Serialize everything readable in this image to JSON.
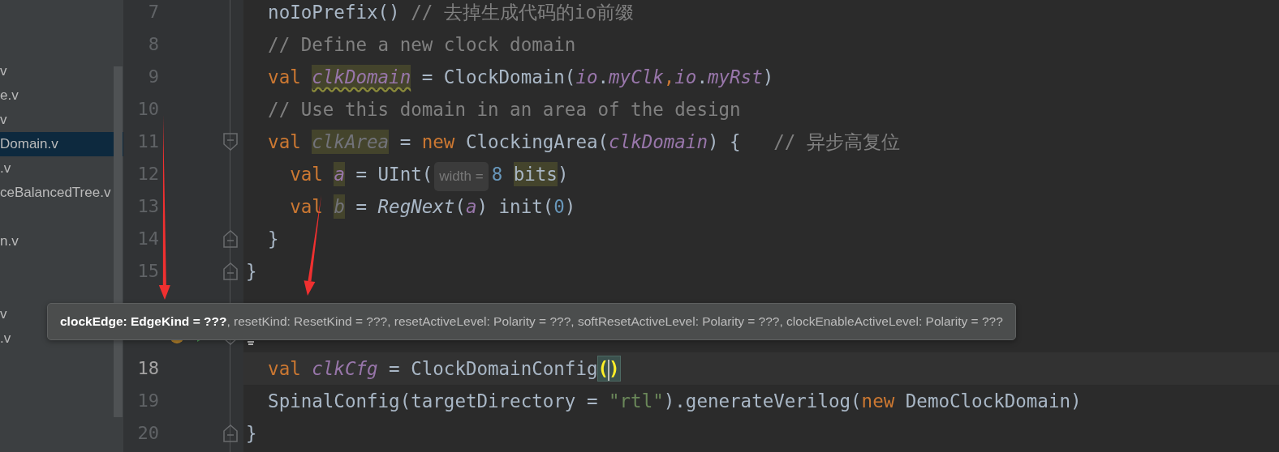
{
  "sidebar": {
    "items": [
      {
        "selected": false
      },
      {
        "selected": false
      },
      {
        "selected": false
      },
      {
        "label": "v",
        "selected": false
      },
      {
        "label": "e.v",
        "selected": false
      },
      {
        "label": "v",
        "selected": false
      },
      {
        "label": "Domain.v",
        "selected": true
      },
      {
        "label": ".v",
        "selected": false
      },
      {
        "label": "ceBalancedTree.v",
        "selected": false
      },
      {
        "selected": false
      },
      {
        "label": "n.v",
        "selected": false
      },
      {
        "selected": false
      },
      {
        "selected": false
      },
      {
        "label": "v",
        "selected": false
      },
      {
        "label": ".v",
        "selected": false
      }
    ]
  },
  "editor": {
    "lines": [
      {
        "number": "7",
        "current": false,
        "fold_start": false,
        "fold_end": false,
        "tokens": [
          {
            "text": "  noIoPrefix() ",
            "kind": "plain"
          },
          {
            "text": "// 去掉生成代码的io前缀",
            "kind": "comment"
          }
        ]
      },
      {
        "number": "8",
        "current": false,
        "fold_start": false,
        "fold_end": false,
        "tokens": [
          {
            "text": "  // Define a new clock domain",
            "kind": "comment"
          }
        ]
      },
      {
        "number": "9",
        "current": false,
        "fold_start": false,
        "fold_end": false,
        "tokens": [
          {
            "text": "  val ",
            "kind": "keyword"
          },
          {
            "text": "clkDomain",
            "kind": "field-warn"
          },
          {
            "text": " = ClockDomain(",
            "kind": "plain"
          },
          {
            "text": "io",
            "kind": "field"
          },
          {
            "text": ".",
            "kind": "plain"
          },
          {
            "text": "myClk",
            "kind": "field"
          },
          {
            "text": ",",
            "kind": "keyword"
          },
          {
            "text": "io",
            "kind": "field"
          },
          {
            "text": ".",
            "kind": "plain"
          },
          {
            "text": "myRst",
            "kind": "field"
          },
          {
            "text": ")",
            "kind": "plain"
          }
        ]
      },
      {
        "number": "10",
        "current": false,
        "fold_start": false,
        "fold_end": false,
        "tokens": [
          {
            "text": "  // Use this domain in an area of the design",
            "kind": "comment"
          }
        ]
      },
      {
        "number": "11",
        "current": false,
        "fold_start": true,
        "fold_end": false,
        "tokens": [
          {
            "text": "  val ",
            "kind": "keyword"
          },
          {
            "text": "clkArea",
            "kind": "unused"
          },
          {
            "text": " = ",
            "kind": "plain"
          },
          {
            "text": "new",
            "kind": "keyword"
          },
          {
            "text": " ClockingArea(",
            "kind": "plain"
          },
          {
            "text": "clkDomain",
            "kind": "field"
          },
          {
            "text": ") {   ",
            "kind": "plain"
          },
          {
            "text": "// 异步高复位",
            "kind": "comment"
          }
        ]
      },
      {
        "number": "12",
        "current": false,
        "fold_start": false,
        "fold_end": false,
        "tokens": [
          {
            "text": "    val ",
            "kind": "keyword"
          },
          {
            "text": "a",
            "kind": "field-mark"
          },
          {
            "text": " = UInt(",
            "kind": "plain"
          },
          {
            "text": "width =",
            "kind": "hint"
          },
          {
            "text": "8 ",
            "kind": "number"
          },
          {
            "text": "bits",
            "kind": "plain-mark"
          },
          {
            "text": ")",
            "kind": "plain"
          }
        ]
      },
      {
        "number": "13",
        "current": false,
        "fold_start": false,
        "fold_end": false,
        "tokens": [
          {
            "text": "    val ",
            "kind": "keyword"
          },
          {
            "text": "b",
            "kind": "unused"
          },
          {
            "text": " = ",
            "kind": "plain"
          },
          {
            "text": "RegNext",
            "kind": "call"
          },
          {
            "text": "(",
            "kind": "plain"
          },
          {
            "text": "a",
            "kind": "field"
          },
          {
            "text": ") init(",
            "kind": "plain"
          },
          {
            "text": "0",
            "kind": "number"
          },
          {
            "text": ")",
            "kind": "plain"
          }
        ]
      },
      {
        "number": "14",
        "current": false,
        "fold_start": false,
        "fold_end": true,
        "tokens": [
          {
            "text": "  }",
            "kind": "plain"
          }
        ]
      },
      {
        "number": "15",
        "current": false,
        "fold_start": false,
        "fold_end": true,
        "tokens": [
          {
            "text": "}",
            "kind": "plain"
          }
        ]
      },
      {
        "fold_start": false,
        "fold_end": false
      },
      {
        "current": false,
        "fold_start": true,
        "fold_end": false,
        "runnable": true,
        "intention": true
      },
      {
        "number": "18",
        "current": true,
        "fold_start": false,
        "fold_end": false,
        "tokens": [
          {
            "text": "  val ",
            "kind": "keyword"
          },
          {
            "text": "clkCfg",
            "kind": "field"
          },
          {
            "text": " = ClockDomainConfig",
            "kind": "plain"
          },
          {
            "text": "()",
            "kind": "brace"
          }
        ]
      },
      {
        "number": "19",
        "current": false,
        "fold_start": false,
        "fold_end": false,
        "tokens": [
          {
            "text": "  SpinalConfig(targetDirectory = ",
            "kind": "plain"
          },
          {
            "text": "\"rtl\"",
            "kind": "string"
          },
          {
            "text": ").generateVerilog(",
            "kind": "plain"
          },
          {
            "text": "new",
            "kind": "keyword"
          },
          {
            "text": " DemoClockDomain)",
            "kind": "plain"
          }
        ]
      },
      {
        "number": "20",
        "current": false,
        "fold_start": false,
        "fold_end": true,
        "tokens": [
          {
            "text": "}",
            "kind": "plain"
          }
        ]
      }
    ]
  },
  "tooltip": {
    "text": "**clockEdge: EdgeKind = ???**, resetKind: ResetKind = ???, resetActiveLevel: Polarity = ???, softResetActiveLevel: Polarity = ???, clockEnableActiveLevel: Polarity = ???"
  },
  "annotations": [
    {
      "kind": "arrow"
    },
    {
      "kind": "arrow"
    }
  ]
}
